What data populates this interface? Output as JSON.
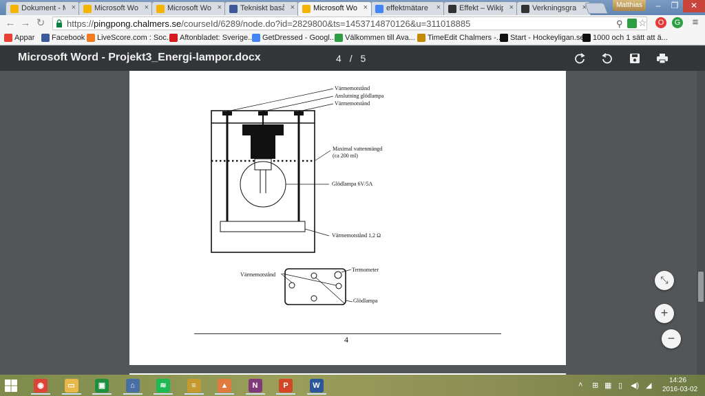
{
  "tabs": [
    {
      "label": "Dokument - M",
      "icon": "drive-icon",
      "color": "#f4b400"
    },
    {
      "label": "Microsoft Wor",
      "icon": "drive-icon",
      "color": "#f4b400"
    },
    {
      "label": "Microsoft Wor",
      "icon": "drive-icon",
      "color": "#f4b400"
    },
    {
      "label": "Tekniskt basår",
      "icon": "facebook-icon",
      "color": "#3b5998"
    },
    {
      "label": "Microsoft Wor",
      "icon": "drive-icon",
      "color": "#f4b400"
    },
    {
      "label": "effektmätare",
      "icon": "google-icon",
      "color": "#4285f4"
    },
    {
      "label": "Effekt – Wikipe",
      "icon": "wikipedia-icon",
      "color": "#333333"
    },
    {
      "label": "Verkningsgrad",
      "icon": "wikipedia-icon",
      "color": "#333333"
    }
  ],
  "user_badge": "Matthias",
  "window": {
    "minimize": "–",
    "maximize": "❐",
    "close": "✕"
  },
  "address": {
    "scheme": "https://",
    "host": "pingpong.chalmers.se",
    "path": "/courseId/6289/node.do?id=2829800&ts=1453714870126&u=311018885"
  },
  "bookmarks": [
    {
      "label": "Appar",
      "icon": "apps-icon",
      "color": "#e94235"
    },
    {
      "label": "Facebook",
      "icon": "facebook-icon",
      "color": "#3b5998"
    },
    {
      "label": "LiveScore.com : Soc...",
      "icon": "livescore-icon",
      "color": "#f47b20"
    },
    {
      "label": "Aftonbladet: Sverige...",
      "icon": "aftonbladet-icon",
      "color": "#d71920"
    },
    {
      "label": "GetDressed - Googl...",
      "icon": "docs-icon",
      "color": "#4285f4"
    },
    {
      "label": "Välkommen till Ava...",
      "icon": "bars-icon",
      "color": "#2e9e44"
    },
    {
      "label": "TimeEdit Chalmers -...",
      "icon": "timeedit-icon",
      "color": "#c28a00"
    },
    {
      "label": "Start - Hockeyligan.se",
      "icon": "shl-icon",
      "color": "#111111"
    },
    {
      "label": "1000 och 1 sätt att ä...",
      "icon": "k7-icon",
      "color": "#111111"
    }
  ],
  "pdf": {
    "title": "Microsoft Word - Projekt3_Energi-lampor.docx",
    "current_page": "4",
    "separator": "/",
    "total_pages": "5",
    "page_number": "4"
  },
  "figure": {
    "labels": {
      "heater_top_1": "Värmemotstånd",
      "bulb_connection": "Anslutning glödlampa",
      "heater_top_2": "Värmemotstånd",
      "max_water": "Maximal vattenmängd",
      "max_water_sub": "(ca 200 ml)",
      "bulb": "Glödlampa 6V/5A",
      "heater_bottom": "Värmemotstånd 1,2  Ω",
      "top_view_heater": "Värmemotstånd",
      "thermometer": "Termometer",
      "top_view_bulb": "Glödlampa"
    }
  },
  "zoom": {
    "fit": "⤡",
    "zoom_in": "+",
    "zoom_out": "−"
  },
  "taskbar": {
    "apps": [
      {
        "name": "chrome",
        "icon": "chrome-icon",
        "color": "#db4437",
        "glyph": "◉"
      },
      {
        "name": "explorer",
        "icon": "folder-icon",
        "color": "#e8b84a",
        "glyph": "▭"
      },
      {
        "name": "store",
        "icon": "store-icon",
        "color": "#1e8f3e",
        "glyph": "▣"
      },
      {
        "name": "home",
        "icon": "home-icon",
        "color": "#4a6fa5",
        "glyph": "⌂"
      },
      {
        "name": "spotify",
        "icon": "spotify-icon",
        "color": "#1db954",
        "glyph": "≋"
      },
      {
        "name": "notes",
        "icon": "notes-icon",
        "color": "#c79a30",
        "glyph": "≡"
      },
      {
        "name": "photos",
        "icon": "photos-icon",
        "color": "#e07a3f",
        "glyph": "▲"
      },
      {
        "name": "onenote",
        "icon": "onenote-icon",
        "color": "#80397b",
        "glyph": "N"
      },
      {
        "name": "powerpoint",
        "icon": "powerpoint-icon",
        "color": "#d24726",
        "glyph": "P"
      },
      {
        "name": "word",
        "icon": "word-icon",
        "color": "#2b579a",
        "glyph": "W"
      }
    ],
    "clock_time": "14:26",
    "clock_date": "2016-03-02"
  }
}
